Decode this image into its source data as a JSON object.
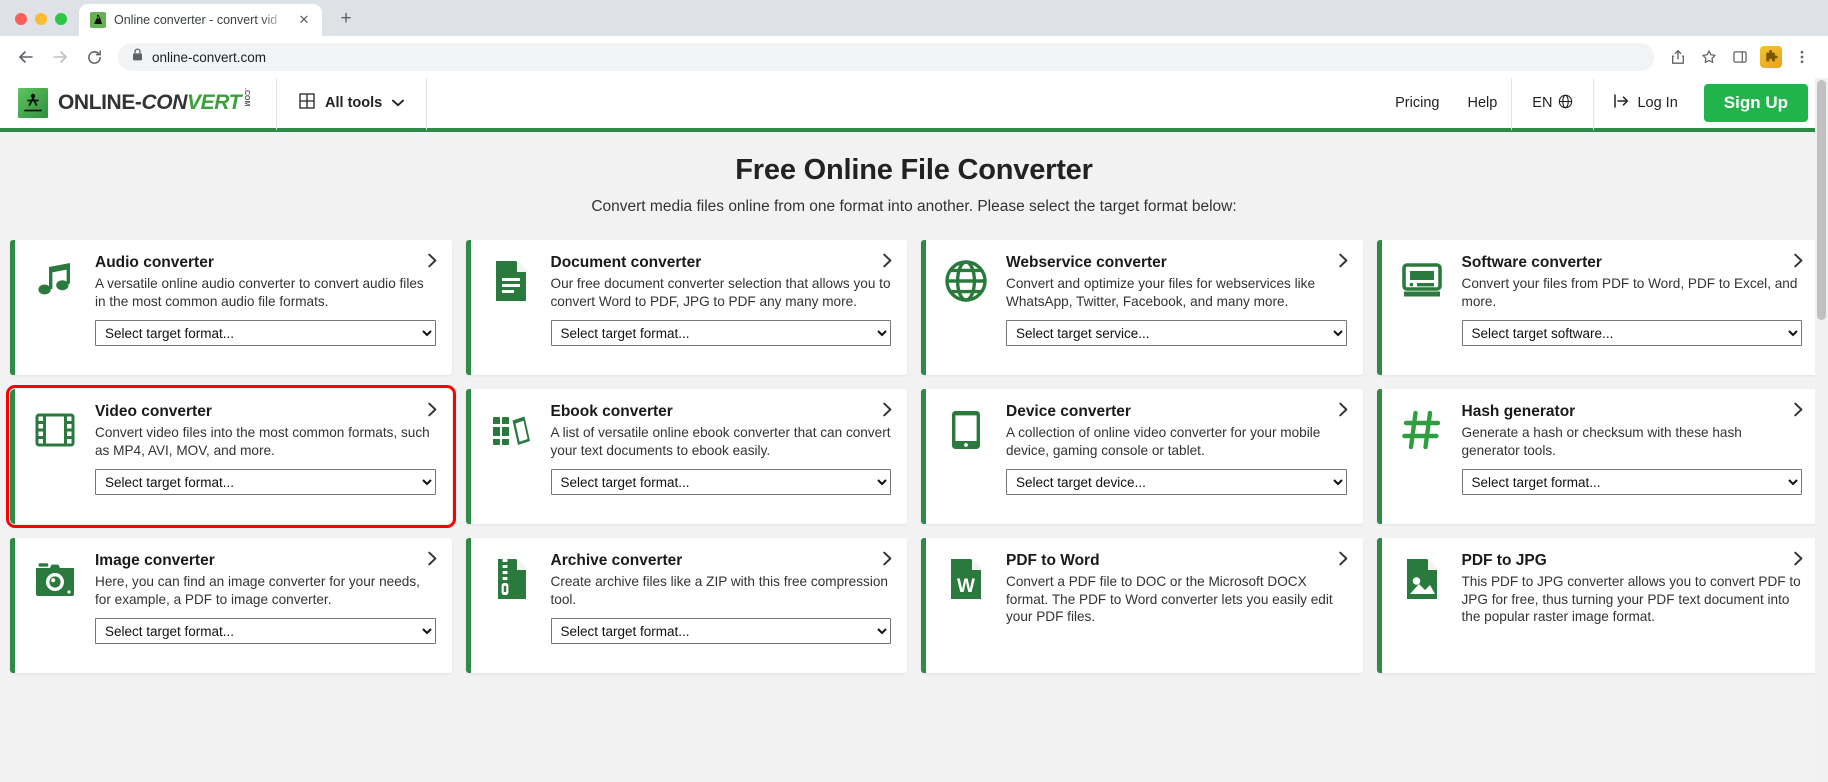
{
  "browser": {
    "tab": {
      "title": "Online converter - convert vid",
      "favicon_icon": "online-convert-favicon",
      "close_icon": "close-icon"
    },
    "new_tab_label": "+",
    "nav": {
      "back_icon": "back-arrow-icon",
      "forward_icon": "forward-arrow-icon",
      "reload_icon": "reload-icon"
    },
    "omnibox": {
      "url": "online-convert.com",
      "lock_icon": "lock-icon"
    },
    "toolbar_icons": [
      "share-icon",
      "bookmark-star-icon",
      "sidebar-panel-icon",
      "extension-puzzle-icon",
      "chrome-menu-icon"
    ]
  },
  "site_header": {
    "logo": {
      "part1": "ONLINE-",
      "part2": "CON",
      "part3": "VERT",
      "tld": ".COM",
      "mark_icon": "running-man-logo-icon"
    },
    "all_tools": {
      "label": "All tools",
      "grid_icon": "grid-icon",
      "chevron_icon": "chevron-down-icon"
    },
    "pricing": "Pricing",
    "help": "Help",
    "language": {
      "label": "EN",
      "globe_icon": "globe-icon"
    },
    "login": {
      "label": "Log In",
      "icon": "login-arrow-icon"
    },
    "signup": "Sign Up"
  },
  "hero": {
    "title": "Free Online File Converter",
    "subtitle": "Convert media files online from one format into another. Please select the target format below:"
  },
  "colors": {
    "brand_green": "#2e8b45",
    "signup_green": "#21b44c",
    "highlight_red": "#fa0000",
    "icon_green": "#2b7a3d"
  },
  "cards": [
    {
      "id": "audio-converter",
      "icon": "music-note-icon",
      "title": "Audio converter",
      "desc": "A versatile online audio converter to convert audio files in the most common audio file formats.",
      "select_placeholder": "Select target format...",
      "arrow_icon": "chevron-right-icon",
      "highlighted": false
    },
    {
      "id": "document-converter",
      "icon": "document-icon",
      "title": "Document converter",
      "desc": "Our free document converter selection that allows you to convert Word to PDF, JPG to PDF any many more.",
      "select_placeholder": "Select target format...",
      "arrow_icon": "chevron-right-icon",
      "highlighted": false
    },
    {
      "id": "webservice-converter",
      "icon": "globe-icon",
      "title": "Webservice converter",
      "desc": "Convert and optimize your files for webservices like WhatsApp, Twitter, Facebook, and many more.",
      "select_placeholder": "Select target service...",
      "arrow_icon": "chevron-right-icon",
      "highlighted": false
    },
    {
      "id": "software-converter",
      "icon": "monitor-icon",
      "title": "Software converter",
      "desc": "Convert your files from PDF to Word, PDF to Excel, and more.",
      "select_placeholder": "Select target software...",
      "arrow_icon": "chevron-right-icon",
      "highlighted": false
    },
    {
      "id": "video-converter",
      "icon": "film-strip-icon",
      "title": "Video converter",
      "desc": "Convert video files into the most common formats, such as MP4, AVI, MOV, and more.",
      "select_placeholder": "Select target format...",
      "arrow_icon": "chevron-right-icon",
      "highlighted": true
    },
    {
      "id": "ebook-converter",
      "icon": "books-icon",
      "title": "Ebook converter",
      "desc": "A list of versatile online ebook converter that can convert your text documents to ebook easily.",
      "select_placeholder": "Select target format...",
      "arrow_icon": "chevron-right-icon",
      "highlighted": false
    },
    {
      "id": "device-converter",
      "icon": "tablet-icon",
      "title": "Device converter",
      "desc": "A collection of online video converter for your mobile device, gaming console or tablet.",
      "select_placeholder": "Select target device...",
      "arrow_icon": "chevron-right-icon",
      "highlighted": false
    },
    {
      "id": "hash-generator",
      "icon": "hash-icon",
      "title": "Hash generator",
      "desc": "Generate a hash or checksum with these hash generator tools.",
      "select_placeholder": "Select target format...",
      "arrow_icon": "chevron-right-icon",
      "highlighted": false
    },
    {
      "id": "image-converter",
      "icon": "camera-icon",
      "title": "Image converter",
      "desc": "Here, you can find an image converter for your needs, for example, a PDF to image converter.",
      "select_placeholder": "Select target format...",
      "arrow_icon": "chevron-right-icon",
      "highlighted": false
    },
    {
      "id": "archive-converter",
      "icon": "zip-file-icon",
      "title": "Archive converter",
      "desc": "Create archive files like a ZIP with this free compression tool.",
      "select_placeholder": "Select target format...",
      "arrow_icon": "chevron-right-icon",
      "highlighted": false
    },
    {
      "id": "pdf-to-word",
      "icon": "word-document-icon",
      "title": "PDF to Word",
      "desc": "Convert a PDF file to DOC or the Microsoft DOCX format. The PDF to Word converter lets you easily edit your PDF files.",
      "select_placeholder": null,
      "arrow_icon": "chevron-right-icon",
      "highlighted": false
    },
    {
      "id": "pdf-to-jpg",
      "icon": "image-document-icon",
      "title": "PDF to JPG",
      "desc": "This PDF to JPG converter allows you to convert PDF to JPG for free, thus turning your PDF text document into the popular raster image format.",
      "select_placeholder": null,
      "arrow_icon": "chevron-right-icon",
      "highlighted": false
    }
  ]
}
